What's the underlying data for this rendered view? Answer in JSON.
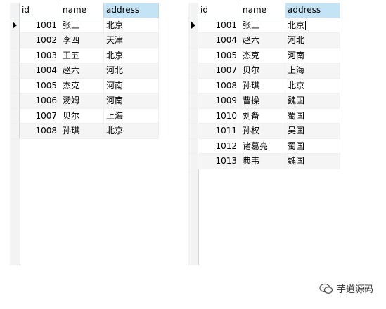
{
  "left_grid": {
    "columns": [
      "id",
      "name",
      "address"
    ],
    "rows": [
      {
        "id": "1001",
        "name": "张三",
        "address": "北京"
      },
      {
        "id": "1002",
        "name": "李四",
        "address": "天津"
      },
      {
        "id": "1003",
        "name": "王五",
        "address": "北京"
      },
      {
        "id": "1004",
        "name": "赵六",
        "address": "河北"
      },
      {
        "id": "1005",
        "name": "杰克",
        "address": "河南"
      },
      {
        "id": "1006",
        "name": "汤姆",
        "address": "河南"
      },
      {
        "id": "1007",
        "name": "贝尔",
        "address": "上海"
      },
      {
        "id": "1008",
        "name": "孙琪",
        "address": "北京"
      }
    ]
  },
  "right_grid": {
    "columns": [
      "id",
      "name",
      "address"
    ],
    "rows": [
      {
        "id": "1001",
        "name": "张三",
        "address": "北京"
      },
      {
        "id": "1004",
        "name": "赵六",
        "address": "河北"
      },
      {
        "id": "1005",
        "name": "杰克",
        "address": "河南"
      },
      {
        "id": "1007",
        "name": "贝尔",
        "address": "上海"
      },
      {
        "id": "1008",
        "name": "孙琪",
        "address": "北京"
      },
      {
        "id": "1009",
        "name": "曹操",
        "address": "魏国"
      },
      {
        "id": "1010",
        "name": "刘备",
        "address": "蜀国"
      },
      {
        "id": "1011",
        "name": "孙权",
        "address": "吴国"
      },
      {
        "id": "1012",
        "name": "诸葛亮",
        "address": "蜀国"
      },
      {
        "id": "1013",
        "name": "典韦",
        "address": "魏国"
      }
    ]
  },
  "watermark": {
    "text": "芋道源码",
    "icon": "wechat-icon"
  },
  "colors": {
    "header_sorted": "#c4e4f5",
    "row_alt": "#f5f5f5",
    "indicator": "#f3f3f3"
  }
}
